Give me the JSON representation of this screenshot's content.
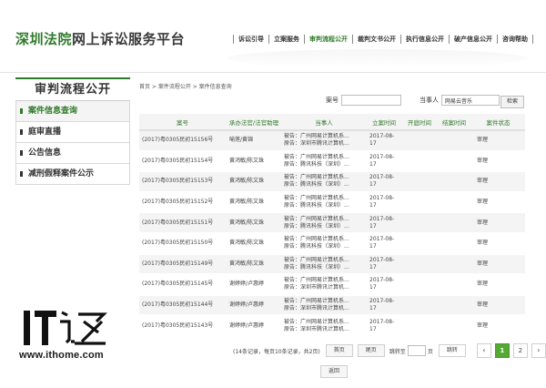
{
  "site": {
    "title_green": "深圳法院",
    "title_dark": "网上诉讼服务平台"
  },
  "top_nav": [
    "诉讼引导",
    "立案服务",
    "审判流程公开",
    "裁判文书公开",
    "执行信息公开",
    "破产信息公开",
    "咨询帮助"
  ],
  "top_nav_active_index": 2,
  "sidebar": {
    "title": "审判流程公开",
    "items": [
      "案件信息查询",
      "庭审直播",
      "公告信息",
      "减刑假释案件公示"
    ]
  },
  "breadcrumb": "首页 > 案件流程公开 > 案件信息查询",
  "search": {
    "case_no_label": "案号",
    "case_no_value": "",
    "party_label": "当事人",
    "party_value": "网易云音乐",
    "button": "检索"
  },
  "table": {
    "headers": [
      "案号",
      "承办法官/法官助理",
      "当事人",
      "立案时间",
      "开庭时间",
      "结案时间",
      "案件状态"
    ],
    "rows": [
      {
        "no": "(2017)粤0305民初15156号",
        "judge": "喻莲/黄锦",
        "p1": "被告：广州网易计算机系...",
        "p2": "原告：深圳市腾讯计算机...",
        "date1": "2017-08-",
        "date2": "17",
        "status": "审理"
      },
      {
        "no": "(2017)粤0305民初15154号",
        "judge": "黄鸿敏/陈文珠",
        "p1": "被告：广州网易计算机系...",
        "p2": "原告：腾讯科技（深圳）...",
        "date1": "2017-08-",
        "date2": "17",
        "status": "审理"
      },
      {
        "no": "(2017)粤0305民初15153号",
        "judge": "黄鸿敏/陈文珠",
        "p1": "被告：广州网易计算机系...",
        "p2": "原告：腾讯科技（深圳）...",
        "date1": "2017-08-",
        "date2": "17",
        "status": "审理"
      },
      {
        "no": "(2017)粤0305民初15152号",
        "judge": "黄鸿敏/陈文珠",
        "p1": "被告：广州网易计算机系...",
        "p2": "原告：腾讯科技（深圳）...",
        "date1": "2017-08-",
        "date2": "17",
        "status": "审理"
      },
      {
        "no": "(2017)粤0305民初15151号",
        "judge": "黄鸿敏/陈文珠",
        "p1": "被告：广州网易计算机系...",
        "p2": "原告：腾讯科技（深圳）...",
        "date1": "2017-08-",
        "date2": "17",
        "status": "审理"
      },
      {
        "no": "(2017)粤0305民初15150号",
        "judge": "黄鸿敏/陈文珠",
        "p1": "被告：广州网易计算机系...",
        "p2": "原告：腾讯科技（深圳）...",
        "date1": "2017-08-",
        "date2": "17",
        "status": "审理"
      },
      {
        "no": "(2017)粤0305民初15149号",
        "judge": "黄鸿敏/陈文珠",
        "p1": "被告：广州网易计算机系...",
        "p2": "原告：腾讯科技（深圳）...",
        "date1": "2017-08-",
        "date2": "17",
        "status": "审理"
      },
      {
        "no": "(2017)粤0305民初15145号",
        "judge": "谢婷婷/卢惠婷",
        "p1": "被告：广州网易计算机系...",
        "p2": "原告：深圳市腾讯计算机...",
        "date1": "2017-08-",
        "date2": "17",
        "status": "审理"
      },
      {
        "no": "(2017)粤0305民初15144号",
        "judge": "谢婷婷/卢惠婷",
        "p1": "被告：广州网易计算机系...",
        "p2": "原告：深圳市腾讯计算机...",
        "date1": "2017-08-",
        "date2": "17",
        "status": "审理"
      },
      {
        "no": "(2017)粤0305民初15143号",
        "judge": "谢婷婷/卢惠婷",
        "p1": "被告：广州网易计算机系...",
        "p2": "原告：深圳市腾讯计算机...",
        "date1": "2017-08-",
        "date2": "17",
        "status": "审理"
      }
    ]
  },
  "pagination": {
    "summary": "(14条记录，每页10条记录，共2页)",
    "first": "首页",
    "last": "尾页",
    "jump_label": "跳转至",
    "jump_unit": "页",
    "go": "跳转",
    "prev": "‹",
    "next": "›",
    "pages": [
      "1",
      "2"
    ],
    "current": "1"
  },
  "back_button": "返回",
  "watermark": {
    "logo": "IT之家",
    "url": "www.ithome.com"
  },
  "colors": {
    "brand_green": "#2f7a2a",
    "page_active": "#55a832"
  }
}
